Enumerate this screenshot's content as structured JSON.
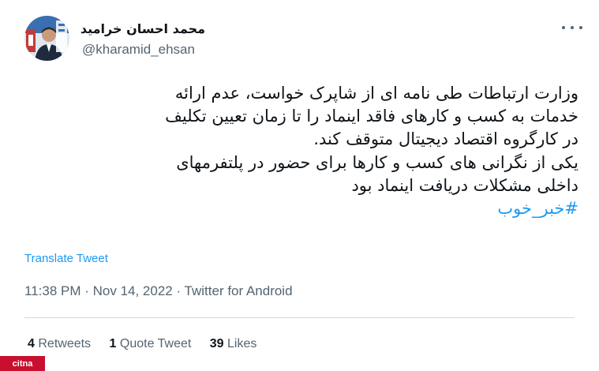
{
  "tweet": {
    "author": {
      "display_name": "محمد احسان خرامید",
      "handle": "@kharamid_ehsan"
    },
    "text_lines": [
      "وزارت ارتباطات طی نامه ای از شاپرک خواست، عدم ارائه",
      "خدمات به کسب و کارهای فاقد اینماد را تا زمان تعیین تکلیف",
      "در کارگروه اقتصاد دیجیتال متوقف کند.",
      "یکی از نگرانی های کسب و کارها برای حضور در پلتفرمهای",
      "داخلی مشکلات دریافت اینماد بود"
    ],
    "hashtag": "#خبر_خوب",
    "translate_label": "Translate Tweet",
    "timestamp": "11:38 PM · Nov 14, 2022 · Twitter for Android",
    "stats": {
      "retweets_count": "4",
      "retweets_label": "Retweets",
      "quotes_count": "1",
      "quotes_label": "Quote Tweet",
      "likes_count": "39",
      "likes_label": "Likes"
    },
    "more_icon": "more-horizontal-icon",
    "link_color": "#1d9bf0"
  },
  "watermark": {
    "text": "citna"
  }
}
